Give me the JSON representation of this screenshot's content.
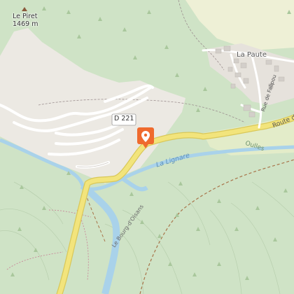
{
  "map": {
    "peak": {
      "name": "Le Piret",
      "elevation": "1469 m"
    },
    "road_shield": "D 221",
    "places": {
      "village": "La Paute",
      "river": "La Lignare",
      "trail": "Le Bourg-d'Oisans",
      "road_route": "Route d",
      "road_falipou": "Rue de Falipou",
      "area_oulles": "Oulles"
    },
    "marker": {
      "icon": "location-pin-icon",
      "color": "#ef6a2e"
    },
    "colors": {
      "forest": "#cfe3c6",
      "rock": "#ece9e3",
      "meadow": "#eef0d6",
      "water": "#a9d2ea",
      "road": "#f2e47c",
      "road_casing": "#d9c85a",
      "building": "#d3cfca"
    }
  }
}
